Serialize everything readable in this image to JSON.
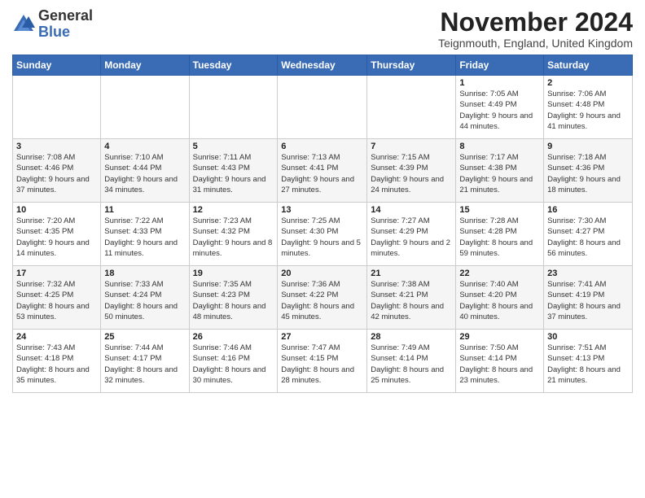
{
  "header": {
    "logo_general": "General",
    "logo_blue": "Blue",
    "month_title": "November 2024",
    "location": "Teignmouth, England, United Kingdom"
  },
  "days_of_week": [
    "Sunday",
    "Monday",
    "Tuesday",
    "Wednesday",
    "Thursday",
    "Friday",
    "Saturday"
  ],
  "weeks": [
    [
      {
        "day": "",
        "info": ""
      },
      {
        "day": "",
        "info": ""
      },
      {
        "day": "",
        "info": ""
      },
      {
        "day": "",
        "info": ""
      },
      {
        "day": "",
        "info": ""
      },
      {
        "day": "1",
        "info": "Sunrise: 7:05 AM\nSunset: 4:49 PM\nDaylight: 9 hours and 44 minutes."
      },
      {
        "day": "2",
        "info": "Sunrise: 7:06 AM\nSunset: 4:48 PM\nDaylight: 9 hours and 41 minutes."
      }
    ],
    [
      {
        "day": "3",
        "info": "Sunrise: 7:08 AM\nSunset: 4:46 PM\nDaylight: 9 hours and 37 minutes."
      },
      {
        "day": "4",
        "info": "Sunrise: 7:10 AM\nSunset: 4:44 PM\nDaylight: 9 hours and 34 minutes."
      },
      {
        "day": "5",
        "info": "Sunrise: 7:11 AM\nSunset: 4:43 PM\nDaylight: 9 hours and 31 minutes."
      },
      {
        "day": "6",
        "info": "Sunrise: 7:13 AM\nSunset: 4:41 PM\nDaylight: 9 hours and 27 minutes."
      },
      {
        "day": "7",
        "info": "Sunrise: 7:15 AM\nSunset: 4:39 PM\nDaylight: 9 hours and 24 minutes."
      },
      {
        "day": "8",
        "info": "Sunrise: 7:17 AM\nSunset: 4:38 PM\nDaylight: 9 hours and 21 minutes."
      },
      {
        "day": "9",
        "info": "Sunrise: 7:18 AM\nSunset: 4:36 PM\nDaylight: 9 hours and 18 minutes."
      }
    ],
    [
      {
        "day": "10",
        "info": "Sunrise: 7:20 AM\nSunset: 4:35 PM\nDaylight: 9 hours and 14 minutes."
      },
      {
        "day": "11",
        "info": "Sunrise: 7:22 AM\nSunset: 4:33 PM\nDaylight: 9 hours and 11 minutes."
      },
      {
        "day": "12",
        "info": "Sunrise: 7:23 AM\nSunset: 4:32 PM\nDaylight: 9 hours and 8 minutes."
      },
      {
        "day": "13",
        "info": "Sunrise: 7:25 AM\nSunset: 4:30 PM\nDaylight: 9 hours and 5 minutes."
      },
      {
        "day": "14",
        "info": "Sunrise: 7:27 AM\nSunset: 4:29 PM\nDaylight: 9 hours and 2 minutes."
      },
      {
        "day": "15",
        "info": "Sunrise: 7:28 AM\nSunset: 4:28 PM\nDaylight: 8 hours and 59 minutes."
      },
      {
        "day": "16",
        "info": "Sunrise: 7:30 AM\nSunset: 4:27 PM\nDaylight: 8 hours and 56 minutes."
      }
    ],
    [
      {
        "day": "17",
        "info": "Sunrise: 7:32 AM\nSunset: 4:25 PM\nDaylight: 8 hours and 53 minutes."
      },
      {
        "day": "18",
        "info": "Sunrise: 7:33 AM\nSunset: 4:24 PM\nDaylight: 8 hours and 50 minutes."
      },
      {
        "day": "19",
        "info": "Sunrise: 7:35 AM\nSunset: 4:23 PM\nDaylight: 8 hours and 48 minutes."
      },
      {
        "day": "20",
        "info": "Sunrise: 7:36 AM\nSunset: 4:22 PM\nDaylight: 8 hours and 45 minutes."
      },
      {
        "day": "21",
        "info": "Sunrise: 7:38 AM\nSunset: 4:21 PM\nDaylight: 8 hours and 42 minutes."
      },
      {
        "day": "22",
        "info": "Sunrise: 7:40 AM\nSunset: 4:20 PM\nDaylight: 8 hours and 40 minutes."
      },
      {
        "day": "23",
        "info": "Sunrise: 7:41 AM\nSunset: 4:19 PM\nDaylight: 8 hours and 37 minutes."
      }
    ],
    [
      {
        "day": "24",
        "info": "Sunrise: 7:43 AM\nSunset: 4:18 PM\nDaylight: 8 hours and 35 minutes."
      },
      {
        "day": "25",
        "info": "Sunrise: 7:44 AM\nSunset: 4:17 PM\nDaylight: 8 hours and 32 minutes."
      },
      {
        "day": "26",
        "info": "Sunrise: 7:46 AM\nSunset: 4:16 PM\nDaylight: 8 hours and 30 minutes."
      },
      {
        "day": "27",
        "info": "Sunrise: 7:47 AM\nSunset: 4:15 PM\nDaylight: 8 hours and 28 minutes."
      },
      {
        "day": "28",
        "info": "Sunrise: 7:49 AM\nSunset: 4:14 PM\nDaylight: 8 hours and 25 minutes."
      },
      {
        "day": "29",
        "info": "Sunrise: 7:50 AM\nSunset: 4:14 PM\nDaylight: 8 hours and 23 minutes."
      },
      {
        "day": "30",
        "info": "Sunrise: 7:51 AM\nSunset: 4:13 PM\nDaylight: 8 hours and 21 minutes."
      }
    ]
  ]
}
